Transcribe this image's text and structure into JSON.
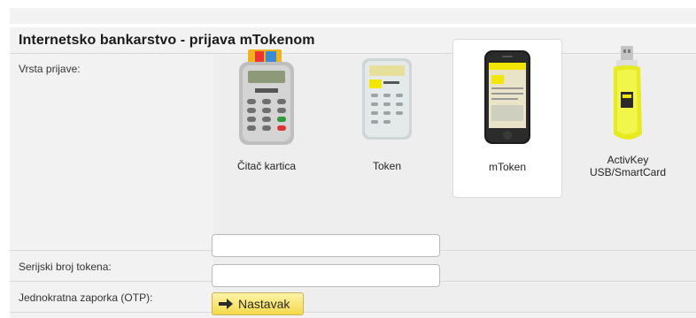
{
  "page": {
    "title": "Internetsko bankarstvo - prijava mTokenom"
  },
  "login_type": {
    "label": "Vrsta prijave:",
    "options": [
      {
        "label": "Čitač kartica",
        "icon": "card-reader-icon",
        "selected": false
      },
      {
        "label": "Token",
        "icon": "token-device-icon",
        "selected": false
      },
      {
        "label": "mToken",
        "icon": "smartphone-icon",
        "selected": true
      },
      {
        "label_line1": "ActivKey",
        "label_line2": "USB/SmartCard",
        "icon": "usb-key-icon",
        "selected": false
      }
    ]
  },
  "serial": {
    "label": "Serijski broj tokena:",
    "value": "",
    "placeholder": ""
  },
  "otp": {
    "label": "Jednokratna zaporka (OTP):",
    "value": "",
    "placeholder": ""
  },
  "submit": {
    "label": "Nastavak",
    "icon": "arrow-right-icon"
  },
  "colors": {
    "panel_bg": "#f2f2f2",
    "button_yellow": "#f5d94a",
    "accent_yellow": "#fff200"
  }
}
